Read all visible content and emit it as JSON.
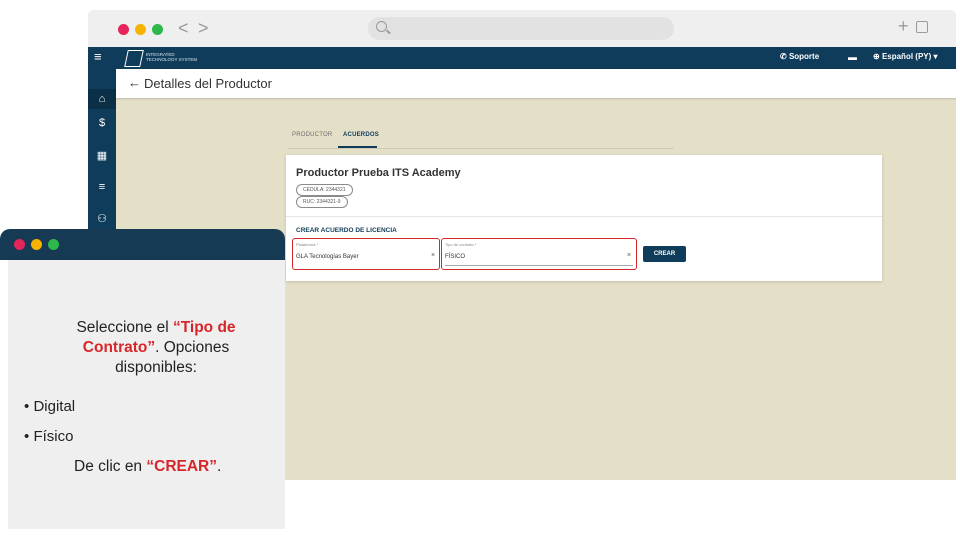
{
  "browser": {
    "back_glyph": "<",
    "forward_glyph": ">",
    "plus_glyph": "+",
    "dot_colors": [
      "#e6245c",
      "#f5b400",
      "#2eb84b"
    ]
  },
  "appbar": {
    "menu_glyph": "≡",
    "logo_text": "INTEGRATED TECHNOLOGY SYSTEM",
    "support_label": "Soporte",
    "language_label": "Español (PY)",
    "colors": {
      "primary": "#0f3c5a",
      "accent": "#d7262a"
    }
  },
  "sidebar": {
    "items": [
      {
        "glyph": "⌂",
        "icon": "home-icon"
      },
      {
        "glyph": "$",
        "icon": "dollar-icon"
      },
      {
        "glyph": "▦",
        "icon": "chart-icon"
      },
      {
        "glyph": "≡",
        "icon": "list-check-icon"
      },
      {
        "glyph": "⚇",
        "icon": "users-icon"
      }
    ]
  },
  "page": {
    "back_glyph": "←",
    "title": "Detalles del Productor"
  },
  "tabs": [
    {
      "label": "PRODUCTOR",
      "active": false
    },
    {
      "label": "ACUERDOS",
      "active": true
    }
  ],
  "producer": {
    "name": "Productor Prueba ITS Academy",
    "cedula": "CÉDULA: 2344321",
    "ruc": "RUC: 2344321-9"
  },
  "form": {
    "section_title": "CREAR ACUERDO DE LICENCIA",
    "platform": {
      "label": "Plataforma *",
      "value": "GLA Tecnologías Bayer",
      "clear": "×"
    },
    "contract_type": {
      "label": "Tipo de contrato *",
      "value": "FÍSICO",
      "clear": "×"
    },
    "submit_label": "CREAR"
  },
  "instructions": {
    "line1_prefix": "Seleccione el ",
    "line1_highlight": "“Tipo de Contrato”",
    "line1_suffix": ". Opciones disponibles:",
    "options": [
      "Digital",
      "Físico"
    ],
    "bullet": "•",
    "click_prefix": "De clic en ",
    "click_highlight": "“CREAR”",
    "click_suffix": "."
  }
}
